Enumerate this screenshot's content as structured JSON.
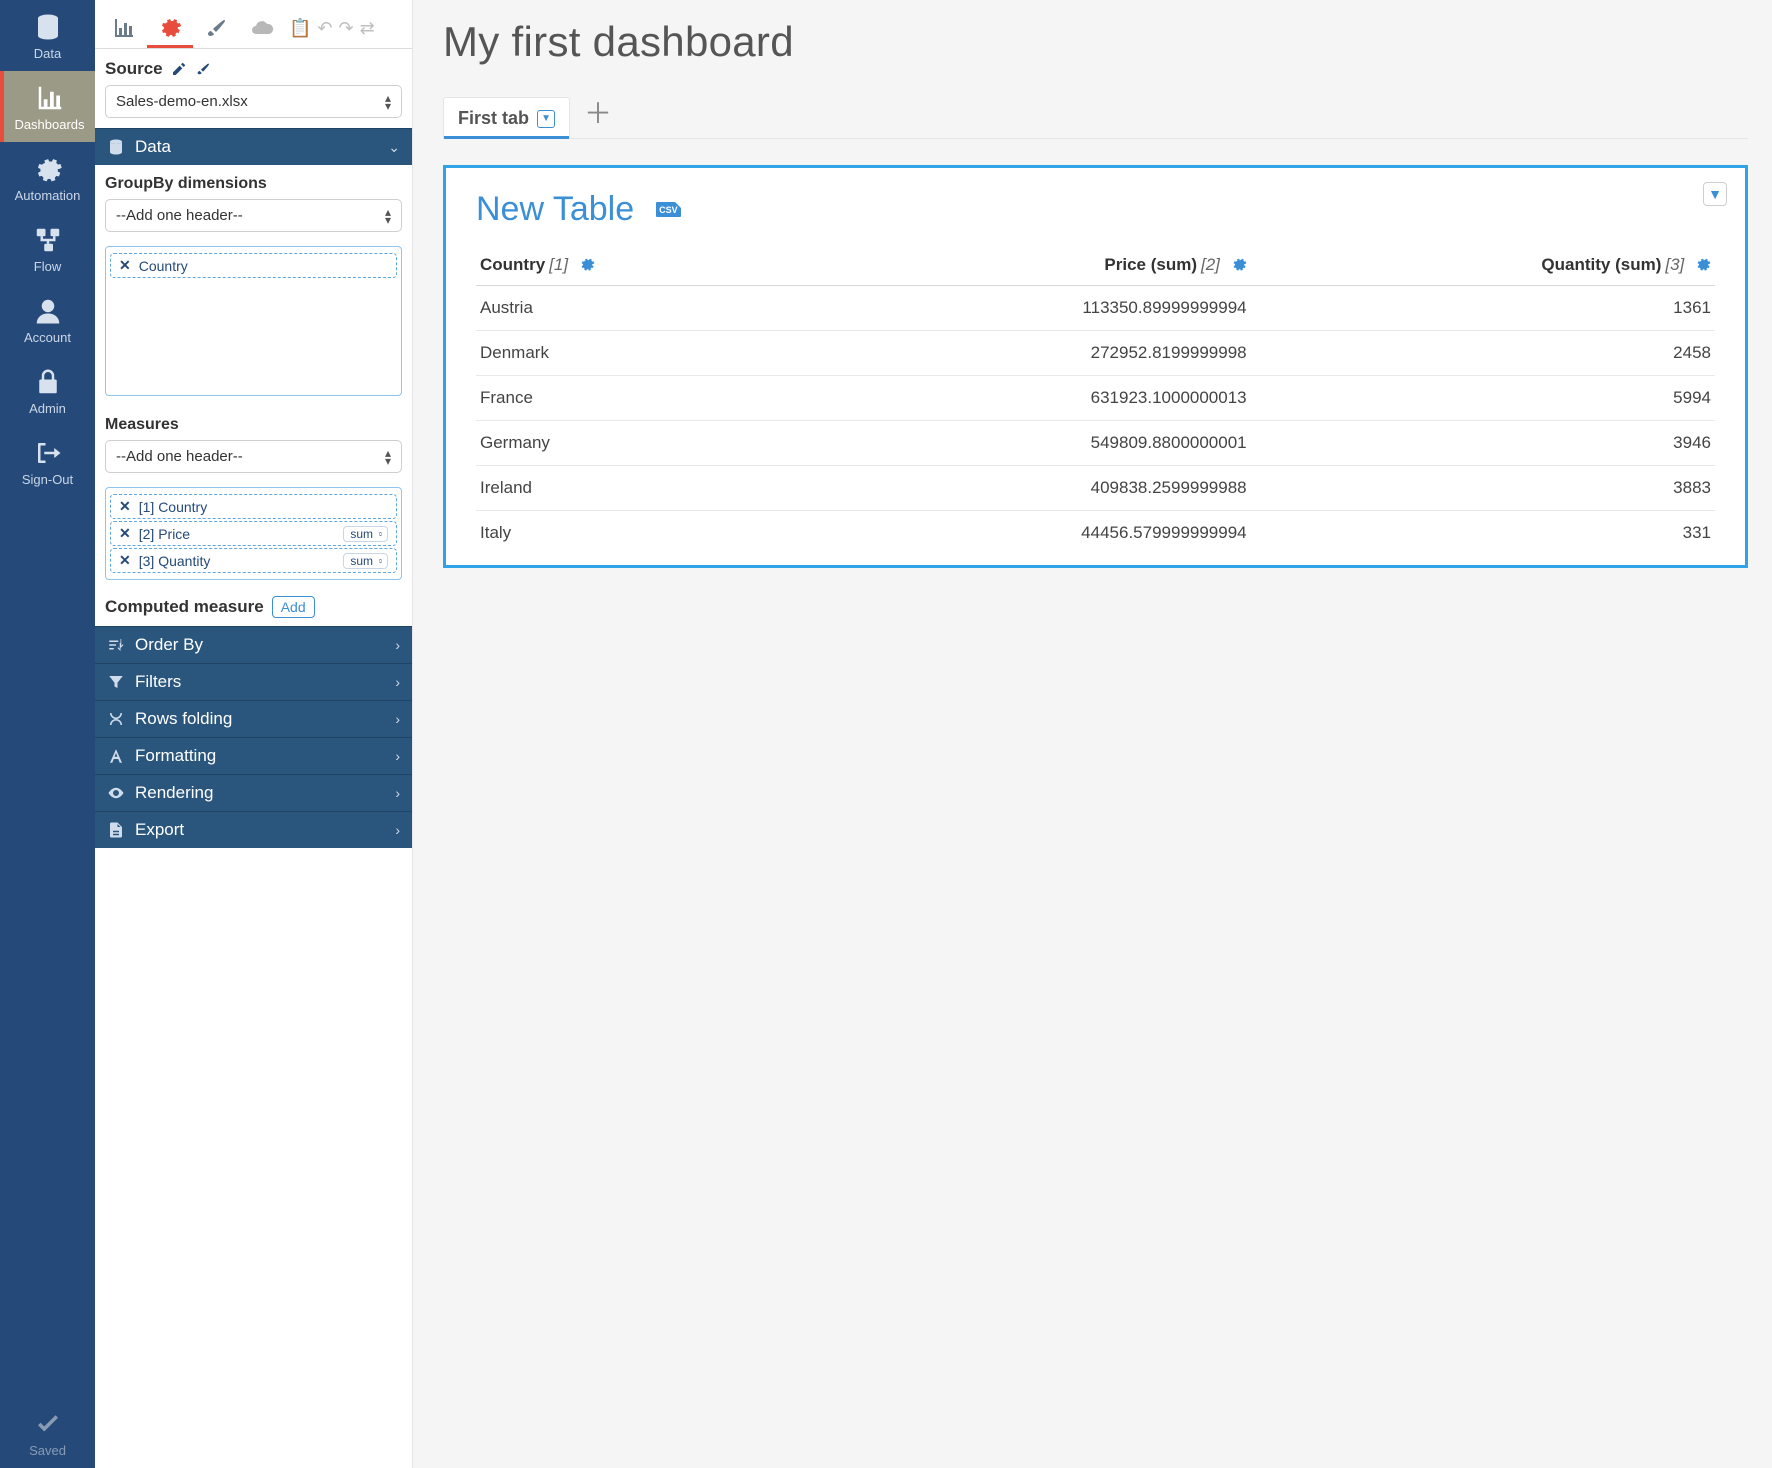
{
  "nav": {
    "items": [
      {
        "key": "data",
        "label": "Data"
      },
      {
        "key": "dashboards",
        "label": "Dashboards"
      },
      {
        "key": "automation",
        "label": "Automation"
      },
      {
        "key": "flow",
        "label": "Flow"
      },
      {
        "key": "account",
        "label": "Account"
      },
      {
        "key": "admin",
        "label": "Admin"
      },
      {
        "key": "signout",
        "label": "Sign-Out"
      }
    ],
    "saved_label": "Saved"
  },
  "panel": {
    "source_label": "Source",
    "source_value": "Sales-demo-en.xlsx",
    "data_header": "Data",
    "groupby_label": "GroupBy dimensions",
    "header_placeholder": "--Add one header--",
    "groupby_chips": [
      {
        "label": "Country"
      }
    ],
    "measures_label": "Measures",
    "measure_chips": [
      {
        "idx": "[1]",
        "label": "Country",
        "agg": null
      },
      {
        "idx": "[2]",
        "label": "Price",
        "agg": "sum"
      },
      {
        "idx": "[3]",
        "label": "Quantity",
        "agg": "sum"
      }
    ],
    "computed_label": "Computed measure",
    "add_label": "Add",
    "sections": [
      {
        "label": "Order By"
      },
      {
        "label": "Filters"
      },
      {
        "label": "Rows folding"
      },
      {
        "label": "Formatting"
      },
      {
        "label": "Rendering"
      },
      {
        "label": "Export"
      }
    ]
  },
  "main": {
    "title": "My first dashboard",
    "tab_label": "First tab",
    "card_title": "New Table",
    "csv_label": "CSV",
    "columns": [
      {
        "label": "Country",
        "idx": "[1]",
        "align": "l"
      },
      {
        "label": "Price (sum)",
        "idx": "[2]",
        "align": "r"
      },
      {
        "label": "Quantity (sum)",
        "idx": "[3]",
        "align": "r"
      }
    ],
    "rows": [
      {
        "c": "Austria",
        "p": "113350.89999999994",
        "q": "1361"
      },
      {
        "c": "Denmark",
        "p": "272952.8199999998",
        "q": "2458"
      },
      {
        "c": "France",
        "p": "631923.1000000013",
        "q": "5994"
      },
      {
        "c": "Germany",
        "p": "549809.8800000001",
        "q": "3946"
      },
      {
        "c": "Ireland",
        "p": "409838.2599999988",
        "q": "3883"
      },
      {
        "c": "Italy",
        "p": "44456.579999999994",
        "q": "331"
      }
    ]
  }
}
